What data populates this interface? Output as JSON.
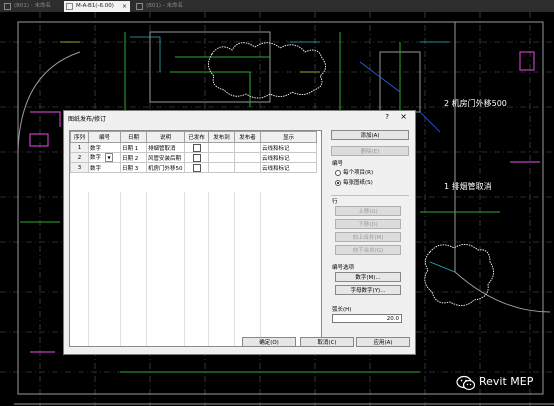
{
  "tabs": [
    {
      "label": "(B01) - 未命名",
      "active": false
    },
    {
      "label": "M-A-B1(-6.00)",
      "active": true
    },
    {
      "label": "(B01) - 未命名",
      "active": false
    }
  ],
  "tab_close": "×",
  "annotations": {
    "note1": "2 机房门外移500",
    "note2": "1 排烟管取消"
  },
  "watermark": {
    "brand": "Revit MEP",
    "icon": "wechat-logo-icon"
  },
  "dialog": {
    "title": "图纸发布/修订",
    "help": "?",
    "close": "×",
    "table": {
      "headers": [
        "序列",
        "编号",
        "日期",
        "说明",
        "已发布",
        "发布到",
        "发布者",
        "显示"
      ],
      "rows": [
        {
          "seq": "1",
          "number": "数字",
          "date": "日期 1",
          "desc": "排烟管取消",
          "issued": false,
          "to": "",
          "by": "",
          "show": "云线和标记"
        },
        {
          "seq": "2",
          "number": "数字",
          "date": "日期 2",
          "desc": "风管安装后期",
          "issued": false,
          "to": "",
          "by": "",
          "show": "云线和标记"
        },
        {
          "seq": "3",
          "number": "数字",
          "date": "日期 3",
          "desc": "机房门外移50",
          "issued": false,
          "to": "",
          "by": "",
          "show": "云线和标记"
        }
      ]
    },
    "buttons": {
      "add": "添加(A)",
      "delete": "删除(E)",
      "move_up": "上移(U)",
      "move_down": "下移(D)",
      "merge_up": "向上合并(M)",
      "merge_down": "向下合并(G)",
      "numbering_numeric": "数字(M)...",
      "numbering_alpha": "字母数字(Y)...",
      "ok": "确定(O)",
      "cancel": "取消(C)",
      "apply": "应用(A)"
    },
    "numbering": {
      "label": "编号",
      "per_project": "每个项目(R)",
      "per_sheet": "每张图纸(S)",
      "selected": "per_sheet"
    },
    "row_label": "行",
    "numbering_options_label": "编号选项",
    "arc_length": {
      "label": "弧长(H)",
      "value": "20.0"
    }
  }
}
